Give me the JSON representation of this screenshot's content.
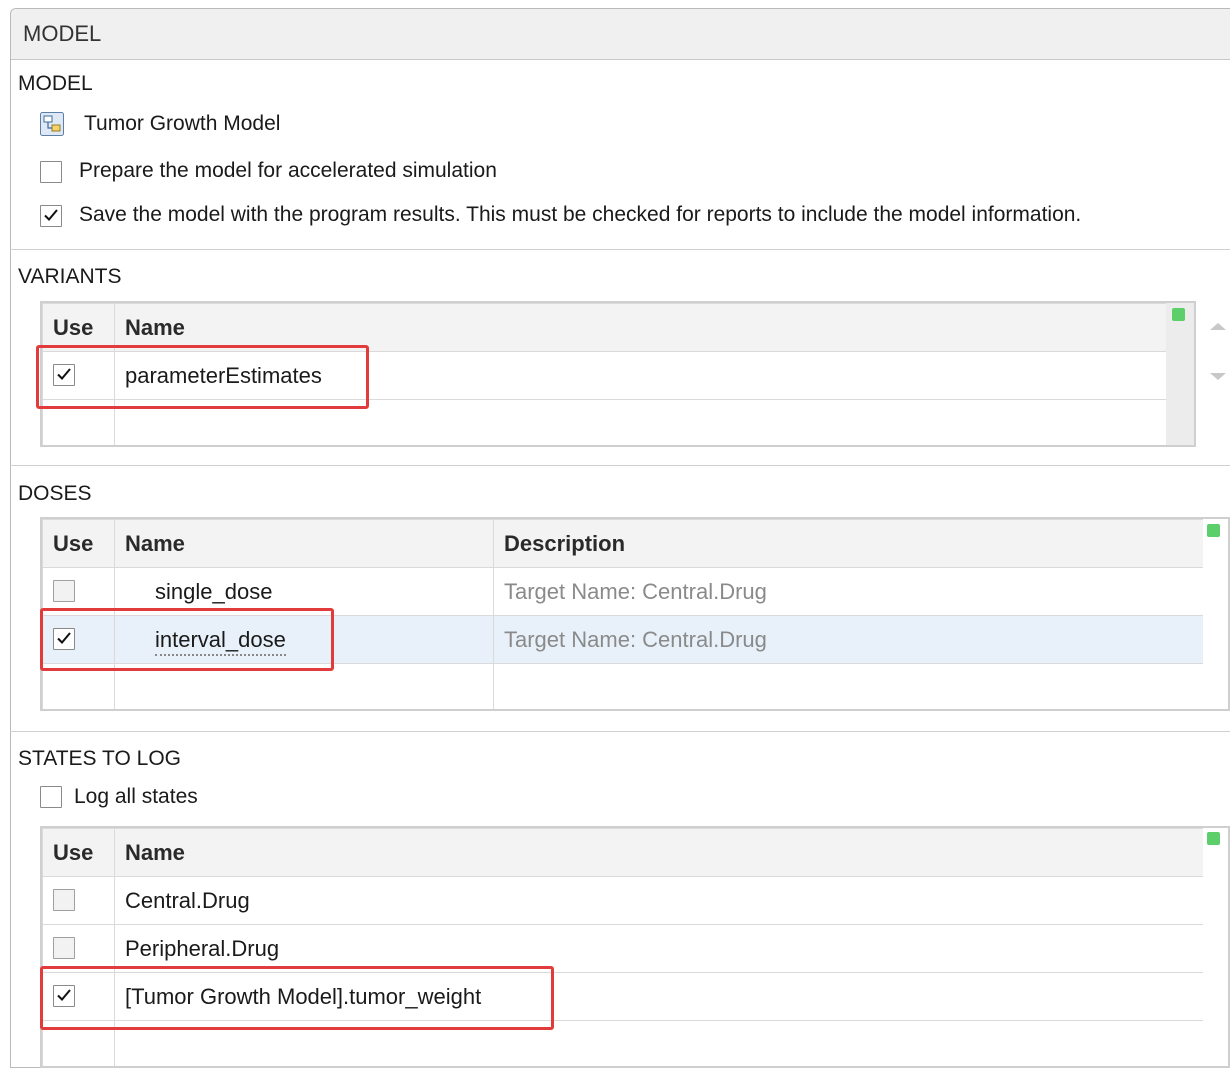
{
  "panel": {
    "title": "MODEL"
  },
  "model": {
    "section_title": "MODEL",
    "model_name": "Tumor Growth Model",
    "prepare_accelerated": {
      "label": "Prepare the model for accelerated simulation",
      "checked": false
    },
    "save_with_results": {
      "label": "Save the model with the program results. This must be checked for reports to include the model information.",
      "checked": true
    }
  },
  "variants": {
    "section_title": "VARIANTS",
    "columns": [
      "Use",
      "Name"
    ],
    "rows": [
      {
        "use": true,
        "name": "parameterEstimates"
      }
    ]
  },
  "doses": {
    "section_title": "DOSES",
    "columns": [
      "Use",
      "Name",
      "Description"
    ],
    "rows": [
      {
        "use": false,
        "name": "single_dose",
        "description": "Target Name: Central.Drug"
      },
      {
        "use": true,
        "name": "interval_dose",
        "description": "Target Name: Central.Drug"
      }
    ]
  },
  "states": {
    "section_title": "STATES TO LOG",
    "log_all": {
      "label": "Log all states",
      "checked": false
    },
    "columns": [
      "Use",
      "Name"
    ],
    "rows": [
      {
        "use": false,
        "name": "Central.Drug"
      },
      {
        "use": false,
        "name": "Peripheral.Drug"
      },
      {
        "use": true,
        "name": "[Tumor Growth Model].tumor_weight"
      }
    ]
  },
  "colors": {
    "highlight": "#e23b3b",
    "status_indicator": "#5ccf6a",
    "selected_row": "#e8f1fa"
  }
}
